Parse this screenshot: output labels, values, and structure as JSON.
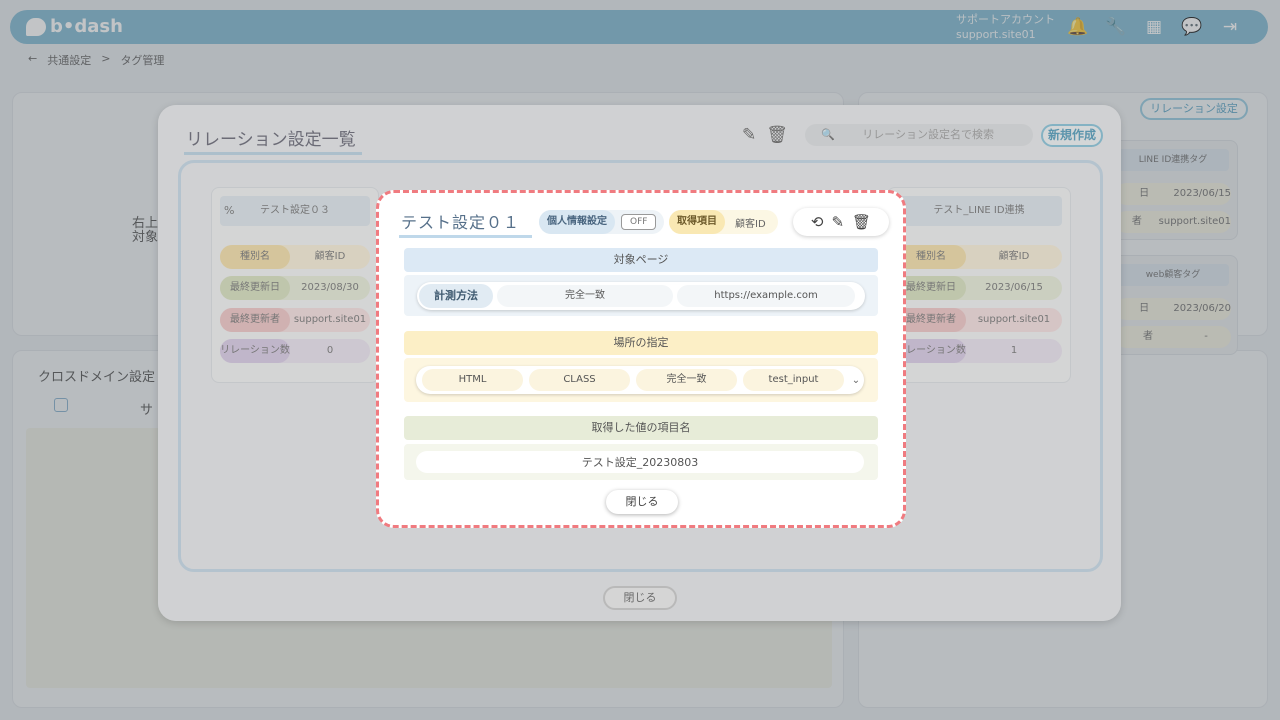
{
  "app": {
    "logo_text": "b•dash",
    "account_name": "サポートアカウント",
    "account_id": "support.site01",
    "icons": [
      "bell-icon",
      "wrench-icon",
      "grid-icon",
      "chat-icon",
      "logout-icon"
    ]
  },
  "breadcrumb": {
    "back": "←",
    "parent": "共通設定",
    "sep": ">",
    "current": "タグ管理"
  },
  "background": {
    "left_text_1": "右上",
    "left_text_2": "対象",
    "cross_domain_title": "クロスドメイン設定",
    "cross_col": "サ",
    "relation_button": "リレーション設定",
    "right_cards": [
      {
        "title": "LINE ID連携タグ",
        "date_key": "日",
        "date": "2023/06/15",
        "user_key": "者",
        "user": "support.site01"
      },
      {
        "title": "web顧客タグ",
        "date_key": "日",
        "date": "2023/06/20",
        "user_key": "者",
        "user": "-"
      }
    ]
  },
  "relation_modal": {
    "title": "リレーション設定一覧",
    "search_placeholder": "リレーション設定名で検索",
    "new_button": "新規作成",
    "close_button": "閉じる",
    "cards": [
      {
        "name": "テスト設定０３",
        "rows": [
          {
            "k": "種別名",
            "v": "顧客ID"
          },
          {
            "k": "最終更新日",
            "v": "2023/08/30"
          },
          {
            "k": "最終更新者",
            "v": "support.site01"
          },
          {
            "k": "リレーション数",
            "v": "0"
          }
        ]
      },
      {
        "name": "テスト_LINE ID連携",
        "rows": [
          {
            "k": "種別名",
            "v": "顧客ID"
          },
          {
            "k": "最終更新日",
            "v": "2023/06/15"
          },
          {
            "k": "最終更新者",
            "v": "support.site01"
          },
          {
            "k": "リレーション数",
            "v": "1"
          }
        ]
      }
    ]
  },
  "detail": {
    "title": "テスト設定０１",
    "personal_info_label": "個人情報設定",
    "personal_info_value": "OFF",
    "item_label": "取得項目",
    "item_value": "顧客ID",
    "target_page": {
      "header": "対象ページ",
      "method_label": "計測方法",
      "match": "完全一致",
      "url": "https://example.com"
    },
    "location": {
      "header": "場所の指定",
      "type": "HTML",
      "attr": "CLASS",
      "match": "完全一致",
      "value": "test_input"
    },
    "value_name": {
      "header": "取得した値の項目名",
      "value": "テスト設定_20230803"
    },
    "close_button": "閉じる"
  }
}
